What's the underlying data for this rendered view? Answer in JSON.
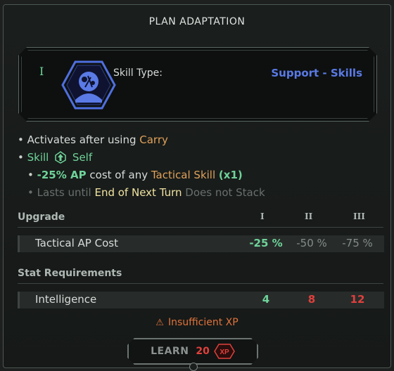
{
  "dialog": {
    "title": "PLAN ADAPTATION"
  },
  "skill": {
    "rank_mark": "I",
    "icon": "tactical-head-icon",
    "type_label": "Skill Type:",
    "type_value": "Support - Skills"
  },
  "description": {
    "bullet": "•",
    "line1_prefix": "Activates after using",
    "line1_ability": "Carry",
    "line2_skill": "Skill",
    "line2_self_icon": "arrow-up-icon",
    "line2_self": "Self",
    "line3_effect": "-25% AP",
    "line3_mid": "cost of any",
    "line3_target": "Tactical Skill",
    "line3_mult": "(x1)",
    "line4_prefix": "Lasts until",
    "line4_duration": "End of Next Turn",
    "line4_stack": "Does not Stack"
  },
  "upgrade": {
    "heading": "Upgrade",
    "levels": [
      "I",
      "II",
      "III"
    ],
    "row_label": "Tactical AP Cost",
    "values": [
      "-25 %",
      "-50 %",
      "-75 %"
    ]
  },
  "requirements": {
    "heading": "Stat Requirements",
    "row_label": "Intelligence",
    "values": [
      "4",
      "8",
      "12"
    ]
  },
  "warning": {
    "icon": "warning-triangle-icon",
    "text": "Insufficient XP"
  },
  "learn_button": {
    "label": "LEARN",
    "cost": "20",
    "currency": "XP"
  },
  "colors": {
    "accent_green": "#6fd39a",
    "accent_orange": "#e0a15a",
    "skill_blue": "#5a7ae6",
    "error_red": "#e0403c"
  }
}
